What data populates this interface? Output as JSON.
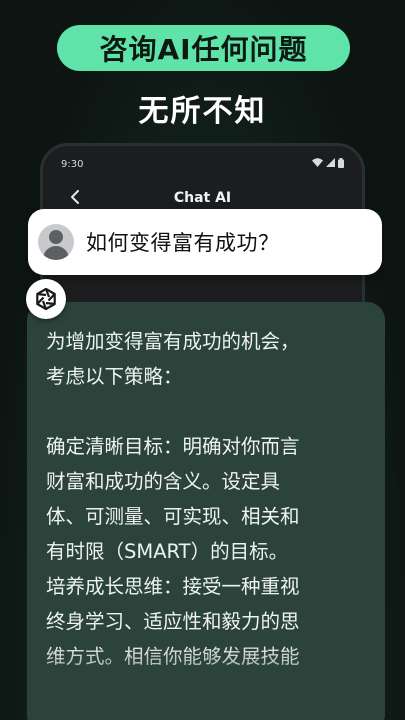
{
  "headline": "咨询AI任何问题",
  "subheadline": "无所不知",
  "status_bar": {
    "time": "9:30"
  },
  "app_bar": {
    "title": "Chat AI",
    "back_icon": "chevron-left-icon"
  },
  "question": {
    "text": "如何变得富有成功？"
  },
  "answer": {
    "lines": [
      "为增加变得富有成功的机会，",
      "考虑以下策略：",
      "",
      "确定清晰目标：明确对你而言",
      "财富和成功的含义。设定具",
      "体、可测量、可实现、相关和",
      "有时限（SMART）的目标。",
      "培养成长思维：接受一种重视",
      "终身学习、适应性和毅力的思",
      "维方式。相信你能够发展技能"
    ]
  },
  "colors": {
    "accent": "#5fe3a8",
    "answer_card": "#2c433b",
    "background": "#0e1614"
  }
}
